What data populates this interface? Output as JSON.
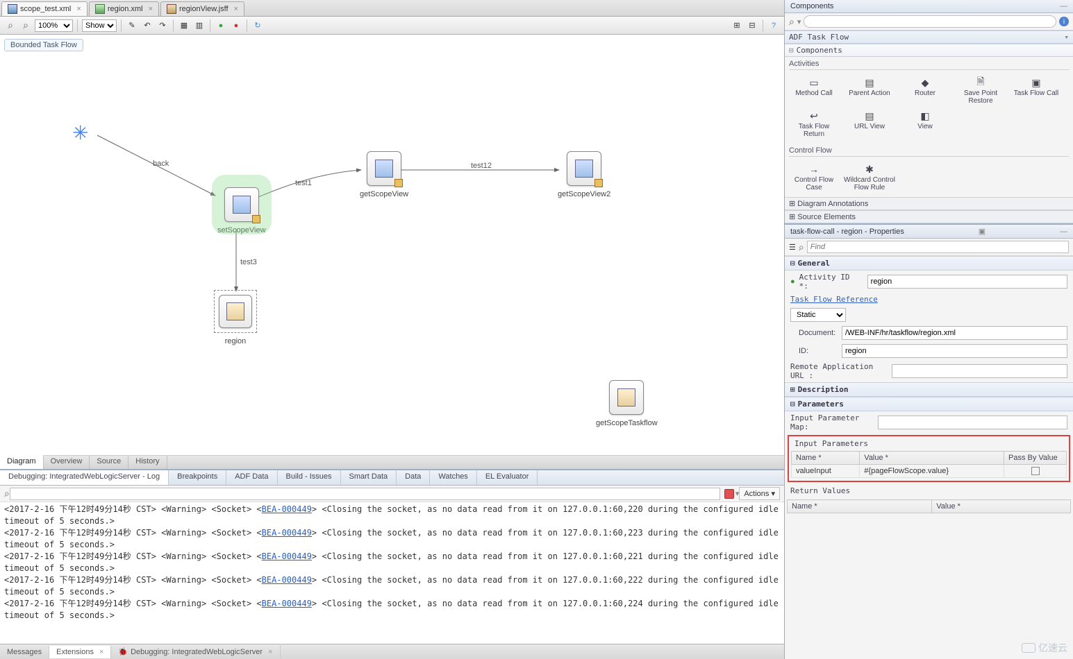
{
  "tabs": [
    {
      "label": "scope_test.xml",
      "icon": "xml-icon",
      "active": true
    },
    {
      "label": "region.xml",
      "icon": "xml-icon2",
      "active": false
    },
    {
      "label": "regionView.jsff",
      "icon": "jsff-icon",
      "active": false
    }
  ],
  "toolbar": {
    "zoom": "100%",
    "show": "Show"
  },
  "diagram": {
    "badge": "Bounded Task Flow",
    "nodes": {
      "setScope": "setScopeView",
      "getScope": "getScopeView",
      "getScope2": "getScopeView2",
      "region": "region",
      "getTaskflow": "getScopeTaskflow"
    },
    "edges": {
      "back": "back",
      "test1": "test1",
      "test12": "test12",
      "test3": "test3"
    }
  },
  "editorBottomTabs": [
    "Diagram",
    "Overview",
    "Source",
    "History"
  ],
  "debug": {
    "tabs": [
      "Debugging: IntegratedWebLogicServer - Log",
      "Breakpoints",
      "ADF Data",
      "Build - Issues",
      "Smart Data",
      "Data",
      "Watches",
      "EL Evaluator"
    ],
    "actions": "Actions",
    "search_placeholder": "",
    "lines": [
      {
        "ts": "2017-2-16 下午12时49分14秒 CST",
        "lvl": "Warning",
        "cat": "Socket",
        "code": "BEA-000449",
        "msg": "Closing the socket, as no data read from it on 127.0.0.1:60,220 during the configured idle timeout of 5 seconds."
      },
      {
        "ts": "2017-2-16 下午12时49分14秒 CST",
        "lvl": "Warning",
        "cat": "Socket",
        "code": "BEA-000449",
        "msg": "Closing the socket, as no data read from it on 127.0.0.1:60,223 during the configured idle timeout of 5 seconds."
      },
      {
        "ts": "2017-2-16 下午12时49分14秒 CST",
        "lvl": "Warning",
        "cat": "Socket",
        "code": "BEA-000449",
        "msg": "Closing the socket, as no data read from it on 127.0.0.1:60,221 during the configured idle timeout of 5 seconds."
      },
      {
        "ts": "2017-2-16 下午12时49分14秒 CST",
        "lvl": "Warning",
        "cat": "Socket",
        "code": "BEA-000449",
        "msg": "Closing the socket, as no data read from it on 127.0.0.1:60,222 during the configured idle timeout of 5 seconds."
      },
      {
        "ts": "2017-2-16 下午12时49分14秒 CST",
        "lvl": "Warning",
        "cat": "Socket",
        "code": "BEA-000449",
        "msg": "Closing the socket, as no data read from it on 127.0.0.1:60,224 during the configured idle timeout of 5 seconds."
      }
    ]
  },
  "footerTabs": [
    {
      "label": "Messages",
      "active": false,
      "closable": false
    },
    {
      "label": "Extensions",
      "active": true,
      "closable": true
    },
    {
      "label": "Debugging: IntegratedWebLogicServer",
      "active": false,
      "closable": true,
      "icon": true
    }
  ],
  "components": {
    "title": "Components",
    "search_placeholder": "",
    "category": "ADF Task Flow",
    "sub": "Components",
    "groups": [
      {
        "label": "Activities",
        "items": [
          {
            "label": "Method Call",
            "icon": "▭"
          },
          {
            "label": "Parent Action",
            "icon": "▤"
          },
          {
            "label": "Router",
            "icon": "◆"
          },
          {
            "label": "Save Point Restore",
            "icon": "🗎"
          },
          {
            "label": "Task Flow Call",
            "icon": "▣"
          },
          {
            "label": "Task Flow Return",
            "icon": "↩"
          },
          {
            "label": "URL View",
            "icon": "▤"
          },
          {
            "label": "View",
            "icon": "◧"
          }
        ]
      },
      {
        "label": "Control Flow",
        "items": [
          {
            "label": "Control Flow Case",
            "icon": "→"
          },
          {
            "label": "Wildcard Control Flow Rule",
            "icon": "✱"
          }
        ]
      }
    ],
    "collapse1": "Diagram Annotations",
    "collapse2": "Source Elements"
  },
  "properties": {
    "title": "task-flow-call - region - Properties",
    "find_placeholder": "Find",
    "sections": {
      "general": "General",
      "activity_id_lbl": "Activity ID *:",
      "activity_id": "region",
      "tfr_link": "Task Flow Reference",
      "static": "Static",
      "document_lbl": "Document:",
      "document": "/WEB-INF/hr/taskflow/region.xml",
      "id_lbl": "ID:",
      "id": "region",
      "remote_lbl": "Remote Application URL :",
      "remote": "",
      "description": "Description",
      "parameters": "Parameters",
      "input_map_lbl": "Input Parameter Map:",
      "input_map": "",
      "input_params": "Input Parameters",
      "cols": {
        "name": "Name *",
        "value": "Value *",
        "pbv": "Pass By Value"
      },
      "row": {
        "name": "valueInput",
        "value": "#{pageFlowScope.value}"
      },
      "return_values": "Return Values",
      "ret_cols": {
        "name": "Name *",
        "value": "Value *"
      }
    }
  },
  "watermark": "亿速云"
}
